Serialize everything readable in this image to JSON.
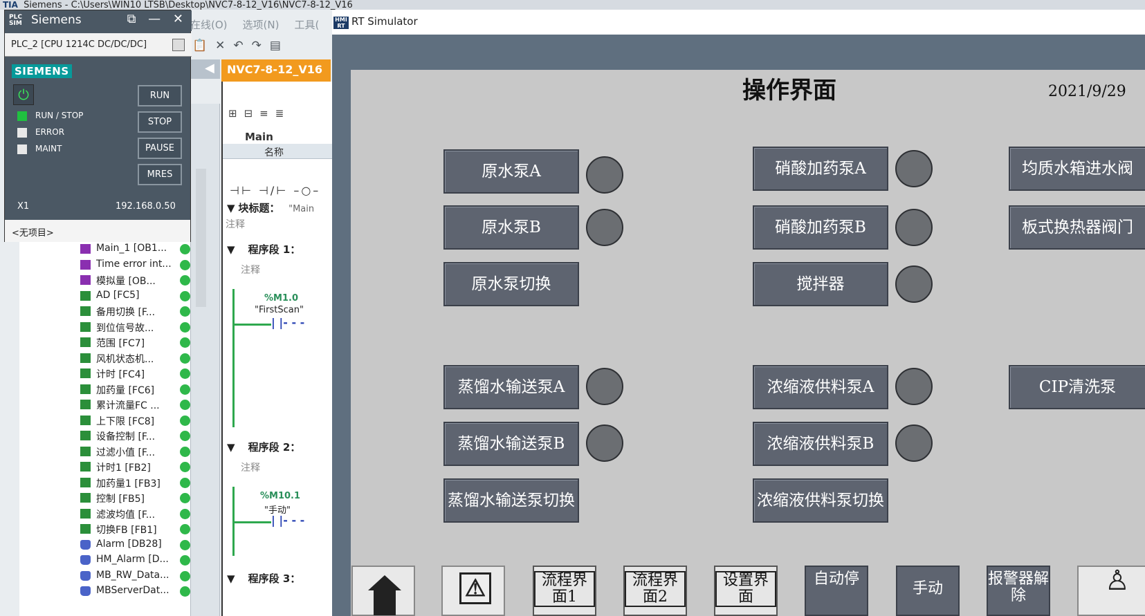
{
  "tia": {
    "title": "Siemens  -  C:\\Users\\WIN10 LTSB\\Desktop\\NVC7-8-12_V16\\NVC7-8-12_V16",
    "logo": "TIA",
    "menu": [
      "在线(O)",
      "选项(N)",
      "工具("
    ],
    "tab": "NVC7-8-12_V16",
    "editor": {
      "main_label": "Main",
      "iface_col": "名称",
      "block_title": "块标题：",
      "block_name": "\"Main",
      "comment": "注释",
      "segment1": "程序段 1：",
      "segment2": "程序段 2：",
      "segment3": "程序段 3：",
      "var1_addr": "%M1.0",
      "var1_name": "\"FirstScan\"",
      "var2_addr": "%M10.1",
      "var2_name": "\"手动\""
    },
    "tree_items": [
      {
        "label": "Main_1 [OB1...",
        "icon": "ob"
      },
      {
        "label": "Time error int...",
        "icon": "ob"
      },
      {
        "label": "模拟量 [OB...",
        "icon": "ob"
      },
      {
        "label": "AD [FC5]",
        "icon": "fc"
      },
      {
        "label": "备用切换 [F...",
        "icon": "fc"
      },
      {
        "label": "到位信号故...",
        "icon": "fc"
      },
      {
        "label": "范围 [FC7]",
        "icon": "fc"
      },
      {
        "label": "风机状态机...",
        "icon": "fc"
      },
      {
        "label": "计时 [FC4]",
        "icon": "fc"
      },
      {
        "label": "加药量 [FC6]",
        "icon": "fc"
      },
      {
        "label": "累计流量FC ...",
        "icon": "fc"
      },
      {
        "label": "上下限 [FC8]",
        "icon": "fc"
      },
      {
        "label": "设备控制 [F...",
        "icon": "fc"
      },
      {
        "label": "过滤小值 [F...",
        "icon": "fc"
      },
      {
        "label": "计时1 [FB2]",
        "icon": "fc"
      },
      {
        "label": "加药量1 [FB3]",
        "icon": "fc"
      },
      {
        "label": "控制 [FB5]",
        "icon": "fc"
      },
      {
        "label": "滤波均值 [F...",
        "icon": "fc"
      },
      {
        "label": "切换FB [FB1]",
        "icon": "fc"
      },
      {
        "label": "Alarm [DB28]",
        "icon": "db"
      },
      {
        "label": "HM_Alarm [D...",
        "icon": "db"
      },
      {
        "label": "MB_RW_Data...",
        "icon": "db"
      },
      {
        "label": "MBServerDat...",
        "icon": "db"
      }
    ]
  },
  "plcsim": {
    "logo": "PLC SIM",
    "title": "Siemens",
    "window_controls": "⧉ — ✕",
    "device": "PLC_2 [CPU 1214C DC/DC/DC]",
    "brand": "SIEMENS",
    "buttons": {
      "run": "RUN",
      "stop": "STOP",
      "pause": "PAUSE",
      "mres": "MRES"
    },
    "leds": [
      {
        "label": "RUN / STOP",
        "on": true
      },
      {
        "label": "ERROR",
        "on": false
      },
      {
        "label": "MAINT",
        "on": false
      }
    ],
    "interface": "X1",
    "ip": "192.168.0.50",
    "project": "<无项目>"
  },
  "rt": {
    "title": "RT Simulator",
    "icon": "HMI RT",
    "heading": "操作界面",
    "date": "2021/9/29",
    "buttons": {
      "raw_pump_a": "原水泵A",
      "raw_pump_b": "原水泵B",
      "raw_pump_switch": "原水泵切换",
      "nitric_pump_a": "硝酸加药泵A",
      "nitric_pump_b": "硝酸加药泵B",
      "mixer": "搅拌器",
      "homogen_valve": "均质水箱进水阀",
      "plate_hx_valve": "板式换热器阀门",
      "distilled_pump_a": "蒸馏水输送泵A",
      "distilled_pump_b": "蒸馏水输送泵B",
      "distilled_pump_switch": "蒸馏水输送泵切换",
      "conc_pump_a": "浓缩液供料泵A",
      "conc_pump_b": "浓缩液供料泵B",
      "conc_pump_switch": "浓缩液供料泵切换",
      "cip_pump": "CIP清洗泵"
    },
    "nav": {
      "flow1": "流程界面1",
      "flow2": "流程界面2",
      "settings": "设置界面",
      "auto_stop": "自动停",
      "manual": "手动",
      "alarm_reset": "报警器解除"
    },
    "colors": {
      "button": "#5e6470",
      "lamp": "#6b6e72",
      "screen": "#c8c8c8"
    }
  }
}
